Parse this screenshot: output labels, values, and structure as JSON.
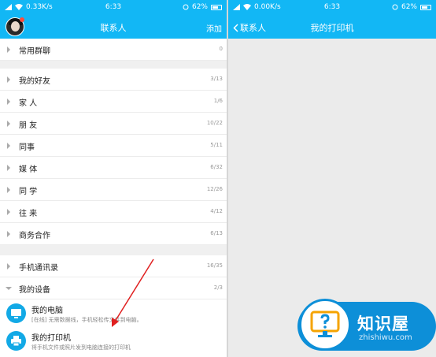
{
  "left_screen": {
    "status": {
      "speed": "0.33K/s",
      "time": "6:33",
      "battery": "62%"
    },
    "title": "联系人",
    "action": "添加",
    "groups_top": [
      {
        "label": "常用群聊",
        "count": "0"
      }
    ],
    "groups_main": [
      {
        "label": "我的好友",
        "count": "3/13"
      },
      {
        "label": "家 人",
        "count": "1/6"
      },
      {
        "label": "朋 友",
        "count": "10/22"
      },
      {
        "label": "同事",
        "count": "5/11"
      },
      {
        "label": "媒 体",
        "count": "6/32"
      },
      {
        "label": "同 学",
        "count": "12/26"
      },
      {
        "label": "往 来",
        "count": "4/12"
      },
      {
        "label": "商务合作",
        "count": "6/13"
      }
    ],
    "groups_bottom": [
      {
        "label": "手机通讯录",
        "count": "16/35"
      },
      {
        "label": "我的设备",
        "count": "2/3"
      }
    ],
    "devices": [
      {
        "name": "我的电脑",
        "desc": "[在线] 无需数据线，手机轻松传文件到电脑。"
      },
      {
        "name": "我的打印机",
        "desc": "将手机文件或照片发到电脑连接的打印机"
      }
    ]
  },
  "right_screen": {
    "status": {
      "speed": "0.00K/s",
      "time": "6:33",
      "battery": "62%"
    },
    "back": "联系人",
    "title": "我的打印机"
  },
  "watermark": {
    "title": "知识屋",
    "subtitle": "zhishiwu.com"
  },
  "colors": {
    "accent": "#12b7f5",
    "background": "#ebebeb",
    "annotation": "#e02020"
  }
}
